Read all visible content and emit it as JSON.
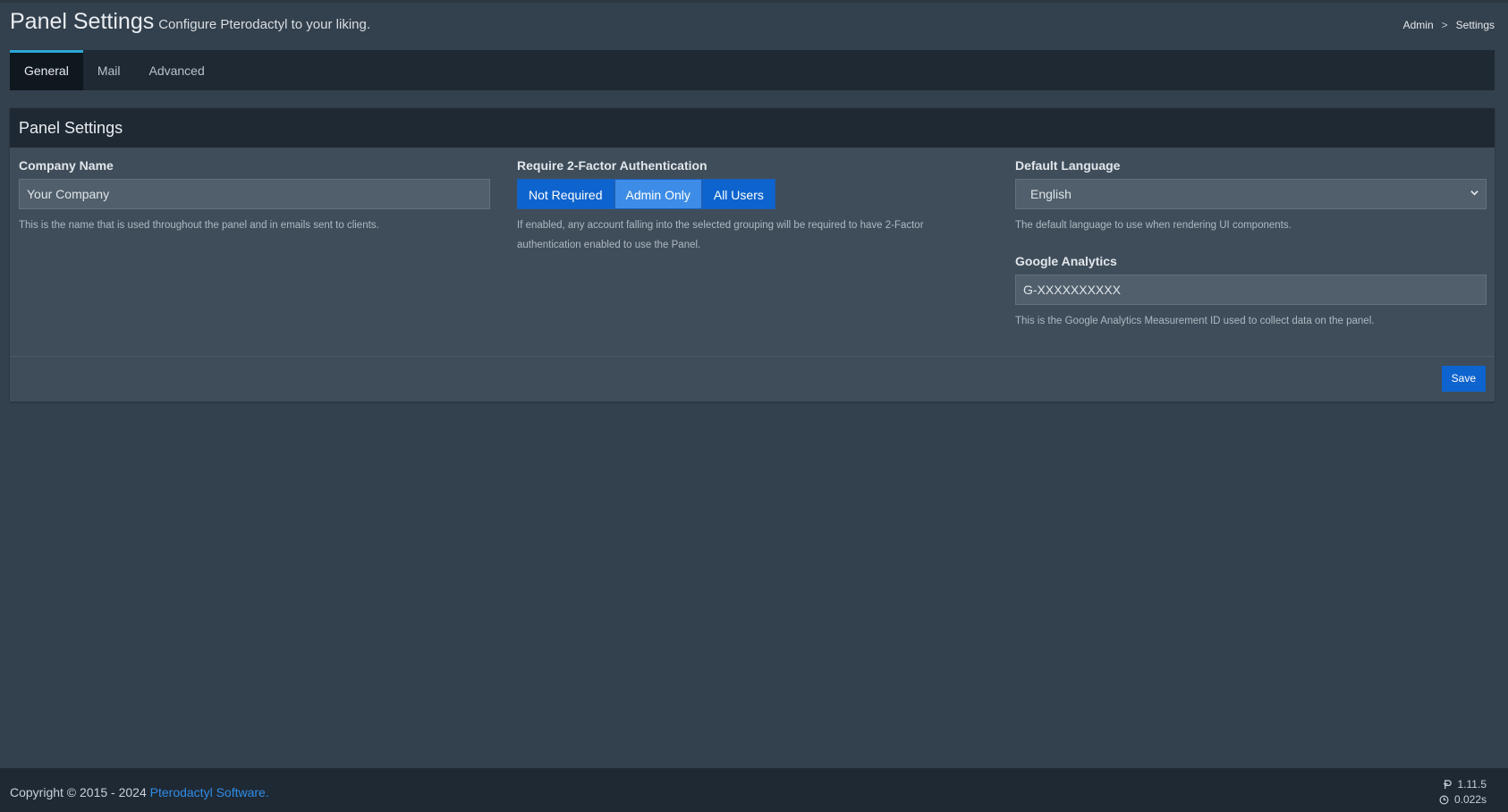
{
  "header": {
    "title": "Panel Settings",
    "subtitle": "Configure Pterodactyl to your liking.",
    "breadcrumb": [
      {
        "label": "Admin"
      },
      {
        "label": "Settings"
      }
    ],
    "breadcrumb_separator": ">"
  },
  "tabs": [
    {
      "label": "General",
      "active": true
    },
    {
      "label": "Mail",
      "active": false
    },
    {
      "label": "Advanced",
      "active": false
    }
  ],
  "panel": {
    "title": "Panel Settings",
    "company_name": {
      "label": "Company Name",
      "value": "Your Company",
      "help": "This is the name that is used throughout the panel and in emails sent to clients."
    },
    "two_factor": {
      "label": "Require 2-Factor Authentication",
      "options": [
        {
          "label": "Not Required",
          "selected": false
        },
        {
          "label": "Admin Only",
          "selected": true
        },
        {
          "label": "All Users",
          "selected": false
        }
      ],
      "help": "If enabled, any account falling into the selected grouping will be required to have 2-Factor authentication enabled to use the Panel."
    },
    "default_language": {
      "label": "Default Language",
      "value": "English",
      "help": "The default language to use when rendering UI components."
    },
    "google_analytics": {
      "label": "Google Analytics",
      "value": "G-XXXXXXXXXX",
      "help": "This is the Google Analytics Measurement ID used to collect data on the panel."
    },
    "save_label": "Save"
  },
  "footer": {
    "copyright_prefix": "Copyright © 2015 - 2024 ",
    "copyright_link": "Pterodactyl Software.",
    "version": "1.11.5",
    "render_time": "0.022s",
    "version_icon": "pterodactyl-p-icon",
    "time_icon": "clock-icon"
  },
  "colors": {
    "background": "#33404d",
    "header_bar": "#1f2933",
    "accent": "#0e64cf",
    "active_tab_border": "#2aa7d4",
    "link": "#2f8ce8"
  }
}
